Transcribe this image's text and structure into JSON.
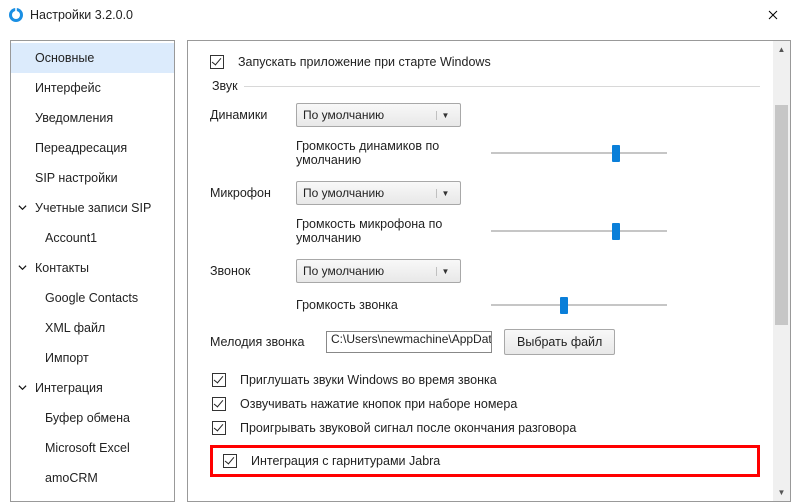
{
  "window": {
    "title": "Настройки 3.2.0.0"
  },
  "sidebar": {
    "items": [
      {
        "label": "Основные",
        "level": 1,
        "expandable": false,
        "selected": true
      },
      {
        "label": "Интерфейс",
        "level": 1,
        "expandable": false,
        "selected": false
      },
      {
        "label": "Уведомления",
        "level": 1,
        "expandable": false,
        "selected": false
      },
      {
        "label": "Переадресация",
        "level": 1,
        "expandable": false,
        "selected": false
      },
      {
        "label": "SIP настройки",
        "level": 1,
        "expandable": false,
        "selected": false
      },
      {
        "label": "Учетные записи SIP",
        "level": 1,
        "expandable": true,
        "selected": false
      },
      {
        "label": "Account1",
        "level": 2,
        "expandable": false,
        "selected": false
      },
      {
        "label": "Контакты",
        "level": 1,
        "expandable": true,
        "selected": false
      },
      {
        "label": "Google Contacts",
        "level": 2,
        "expandable": false,
        "selected": false
      },
      {
        "label": "XML файл",
        "level": 2,
        "expandable": false,
        "selected": false
      },
      {
        "label": "Импорт",
        "level": 2,
        "expandable": false,
        "selected": false
      },
      {
        "label": "Интеграция",
        "level": 1,
        "expandable": true,
        "selected": false
      },
      {
        "label": "Буфер обмена",
        "level": 2,
        "expandable": false,
        "selected": false
      },
      {
        "label": "Microsoft Excel",
        "level": 2,
        "expandable": false,
        "selected": false
      },
      {
        "label": "amoCRM",
        "level": 2,
        "expandable": false,
        "selected": false
      }
    ]
  },
  "main": {
    "autostart_label": "Запускать приложение при старте Windows",
    "sound_legend": "Звук",
    "speakers_label": "Динамики",
    "speakers_value": "По умолчанию",
    "speakers_volume_label": "Громкость динамиков по умолчанию",
    "speakers_volume_pos": 0.72,
    "mic_label": "Микрофон",
    "mic_value": "По умолчанию",
    "mic_volume_label": "Громкость микрофона по умолчанию",
    "mic_volume_pos": 0.72,
    "ring_label": "Звонок",
    "ring_value": "По умолчанию",
    "ring_volume_label": "Громкость звонка",
    "ring_volume_pos": 0.41,
    "melody_label": "Мелодия звонка",
    "melody_path": "C:\\Users\\newmachine\\AppDat",
    "browse_label": "Выбрать файл",
    "mute_windows_label": "Приглушать звуки Windows во время звонка",
    "dial_click_label": "Озвучивать нажатие кнопок при наборе номера",
    "end_call_label": "Проигрывать звуковой сигнал после окончания разговора",
    "jabra_label": "Интеграция с гарнитурами Jabra"
  }
}
